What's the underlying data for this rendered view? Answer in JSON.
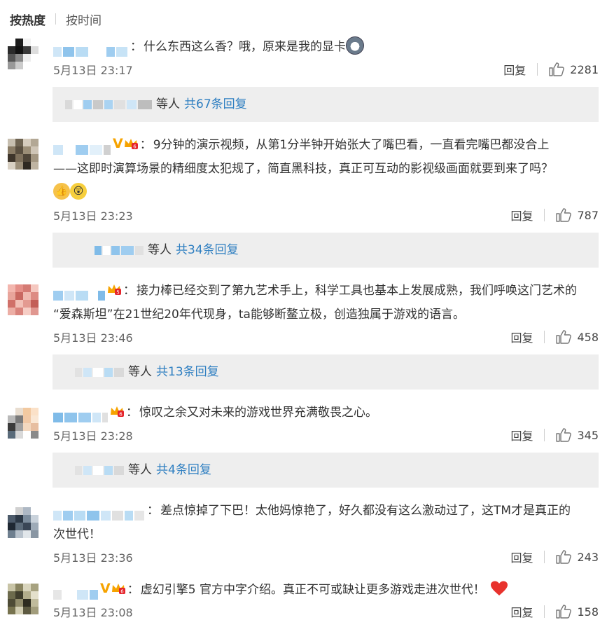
{
  "sort": {
    "hot_label": "按热度",
    "time_label": "按时间"
  },
  "comments": [
    {
      "text": "什么东西这么香？哦，原来是我的显卡",
      "time": "5月13日 23:17",
      "reply_label": "回复",
      "likes": "2281",
      "replies_etc": "等人",
      "replies_count": "共67条回复"
    },
    {
      "text": "9分钟的演示视频，从第1分半钟开始张大了嘴巴看，一直看完嘴巴都没合上",
      "text2": "——这即时演算场景的精细度太犯规了，简直黑科技，真正可互动的影视级画面就要到来了吗？",
      "verified": "V",
      "time": "5月13日 23:23",
      "reply_label": "回复",
      "likes": "787",
      "replies_etc": "等人",
      "replies_count": "共34条回复"
    },
    {
      "text": "接力棒已经交到了第九艺术手上，科学工具也基本上发展成熟，我们呼唤这门艺术的",
      "text2": "“爱森斯坦”在21世纪20年代现身，ta能够断鳌立极，创造独属于游戏的语言。",
      "time": "5月13日 23:46",
      "reply_label": "回复",
      "likes": "458",
      "replies_etc": "等人",
      "replies_count": "共13条回复"
    },
    {
      "text": "惊叹之余又对未来的游戏世界充满敬畏之心。",
      "time": "5月13日 23:28",
      "reply_label": "回复",
      "likes": "345",
      "replies_etc": "等人",
      "replies_count": "共4条回复"
    },
    {
      "text": "差点惊掉了下巴！太他妈惊艳了，好久都没有这么激动过了，这TM才是真正的",
      "text2": "次世代！",
      "time": "5月13日 23:36",
      "reply_label": "回复",
      "likes": "243"
    },
    {
      "text": "虚幻引擎5 官方中字介绍。真正不可或缺让更多游戏走进次世代！",
      "verified": "V",
      "time": "5月13日 23:08",
      "reply_label": "回复",
      "likes": "158"
    }
  ],
  "colors": {
    "link": "#2f7fc1",
    "verified": "#f6a300",
    "reply_bg": "#eeeeee"
  },
  "icons": {
    "like": "thumbs-up-icon",
    "crown": "member-crown-icon",
    "verified": "verified-v-icon"
  }
}
